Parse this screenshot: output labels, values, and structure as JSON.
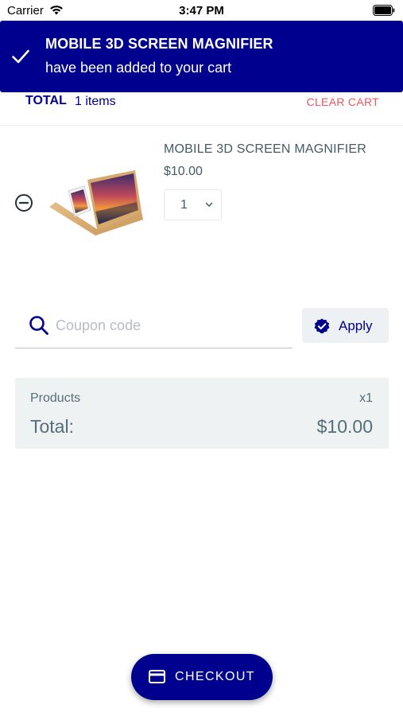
{
  "status_bar": {
    "carrier": "Carrier",
    "time": "3:47 PM",
    "icons": [
      "wifi-icon",
      "battery-icon"
    ]
  },
  "toast": {
    "title": "MOBILE 3D SCREEN MAGNIFIER",
    "message": "have been added to your cart",
    "icon": "check-icon",
    "background": "#00008f"
  },
  "cart": {
    "total_label": "TOTAL",
    "item_count": "1 items",
    "clear_label": "CLEAR CART",
    "items": [
      {
        "name": "MOBILE 3D SCREEN MAGNIFIER",
        "price": "$10.00",
        "quantity": "1",
        "remove_icon": "remove-circle-icon",
        "image": "screen-magnifier-product-image"
      }
    ]
  },
  "coupon": {
    "placeholder": "Coupon code",
    "value": "",
    "search_icon": "search-icon",
    "apply_label": "Apply",
    "apply_icon": "verified-badge-icon"
  },
  "summary": {
    "products_label": "Products",
    "products_qty": "x1",
    "total_label": "Total:",
    "total_value": "$10.00"
  },
  "checkout": {
    "label": "CHECKOUT",
    "icon": "credit-card-icon"
  },
  "colors": {
    "primary": "#00008f",
    "danger": "#f2555f",
    "text": "#455a64",
    "surface": "#eff2f3"
  }
}
